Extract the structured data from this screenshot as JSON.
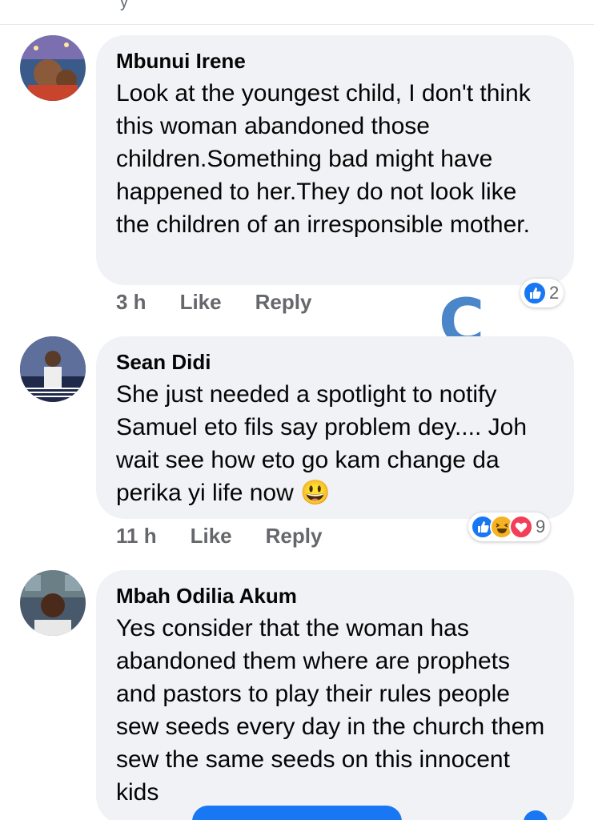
{
  "comments": [
    {
      "author": "Mbunui Irene",
      "text": "Look at the youngest child, I don't think this woman abandoned those children.Something bad might have happened to her.They do not look like the children of an irresponsible mother.",
      "time": "3 h",
      "like_label": "Like",
      "reply_label": "Reply",
      "reactions": [
        "like"
      ],
      "reaction_count": "2"
    },
    {
      "author": "Sean Didi",
      "text": "She just needed a spotlight to notify Samuel  eto fils say problem dey.... Joh wait see how eto go kam change da perika yi life now 😃",
      "time": "11 h",
      "like_label": "Like",
      "reply_label": "Reply",
      "reactions": [
        "like",
        "haha",
        "love"
      ],
      "reaction_count": "9"
    },
    {
      "author": "Mbah Odilia Akum",
      "text": "Yes consider that the woman has abandoned them where are prophets and pastors to play their rules people sew seeds every day in the church them sew the same seeds on this innocent kids"
    }
  ],
  "watermark": "C",
  "colors": {
    "accent": "#1877f2",
    "bubble": "#f0f2f5",
    "secondary_text": "#65676b",
    "love": "#f33e58",
    "haha": "#f7b125"
  }
}
